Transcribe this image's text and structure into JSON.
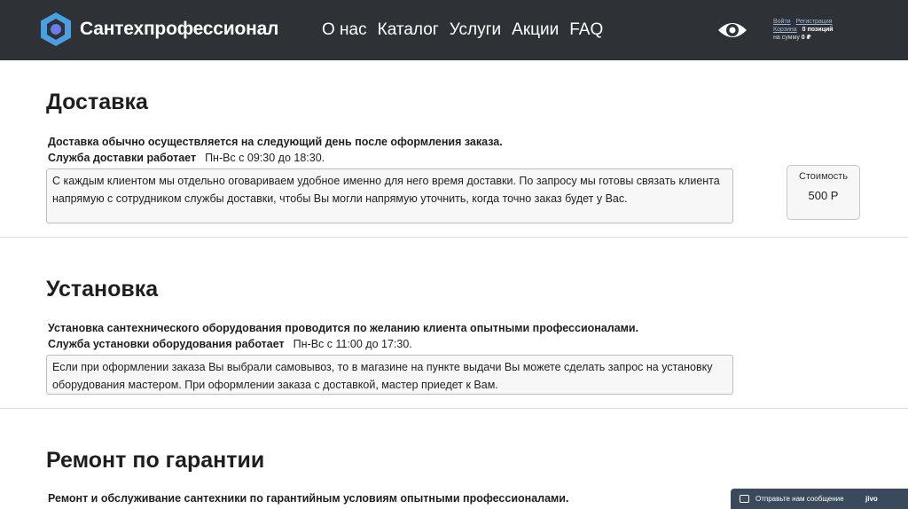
{
  "header": {
    "brand": "Сантехпрофессионал",
    "nav": [
      "О нас",
      "Каталог",
      "Услуги",
      "Акции",
      "FAQ"
    ],
    "user": {
      "login": "Войти",
      "register": "Регистрация",
      "cart": "Корзина",
      "positions": "0 позиций",
      "sum_label": "на сумму",
      "sum_value": "0 ₽"
    }
  },
  "delivery": {
    "title": "Доставка",
    "lead": "Доставка обычно осуществляется на следующий день после оформления заказа.",
    "hours_label": "Служба доставки работает",
    "hours_value": "Пн-Вс с 09:30 до 18:30.",
    "note": "С каждым клиентом мы отдельно оговариваем удобное именно для него время доставки. По запросу мы готовы связать клиента напрямую с сотрудником службы доставки, чтобы Вы могли напрямую уточнить, когда точно заказ будет у Вас.",
    "price_label": "Стоимость",
    "price_value": "500 Р"
  },
  "installation": {
    "title": "Установка",
    "lead": "Установка сантехнического оборудования проводится по желанию клиента опытными профессионалами.",
    "hours_label": "Служба установки оборудования работает",
    "hours_value": "Пн-Вс с 11:00 до 17:30.",
    "note": "Если при оформлении заказа Вы выбрали самовывоз, то в магазине на пункте выдачи Вы можете сделать запрос на установку оборудования мастером. При оформлении заказа с доставкой, мастер приедет к Вам."
  },
  "warranty": {
    "title": "Ремонт по гарантии",
    "lead": "Ремонт и обслуживание сантехники по гарантийным условиям опытными профессионалами."
  },
  "chat": {
    "text": "Отправьте нам сообщение",
    "brand": "jivo"
  }
}
